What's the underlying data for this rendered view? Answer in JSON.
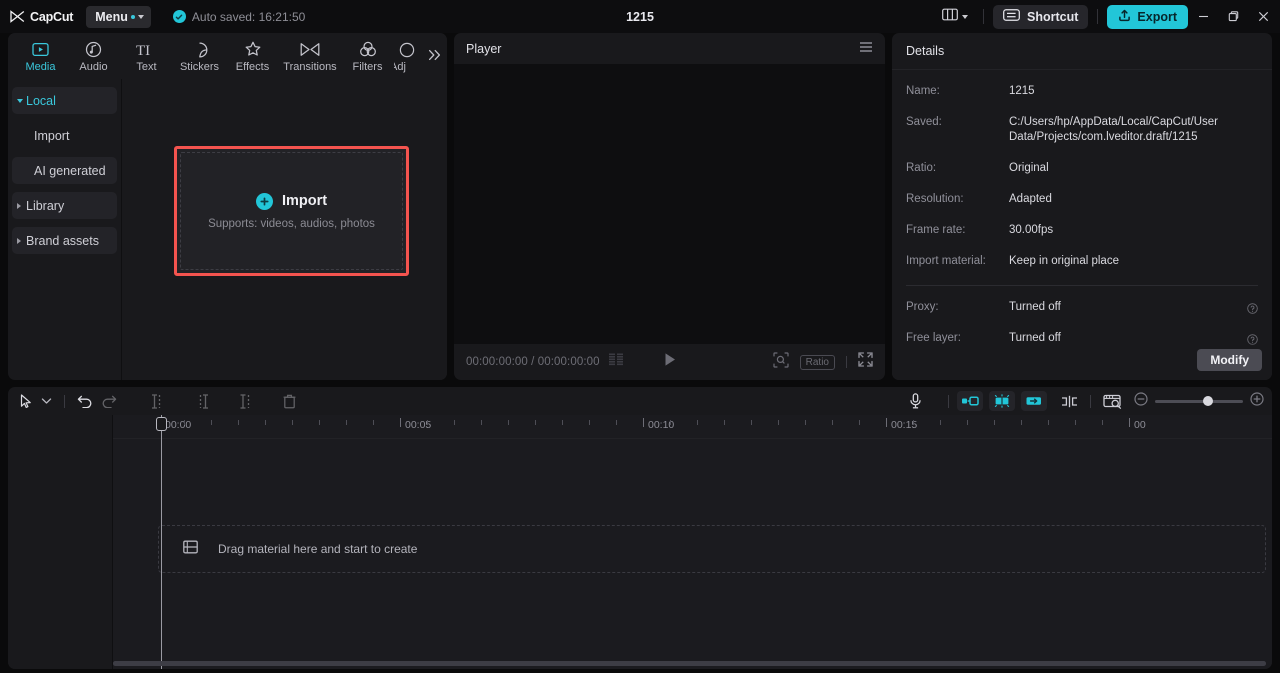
{
  "titlebar": {
    "brand": "CapCut",
    "menu_label": "Menu",
    "autosave_text": "Auto saved: 16:21:50",
    "project_title": "1215",
    "layout_icon": "layout-grid-icon",
    "shortcut_label": "Shortcut",
    "export_label": "Export",
    "minimize": "minimize-icon",
    "maximize": "maximize-icon",
    "close": "close-icon"
  },
  "tabs": [
    {
      "label": "Media",
      "icon": "media-play-icon",
      "active": true
    },
    {
      "label": "Audio",
      "icon": "audio-note-icon",
      "active": false
    },
    {
      "label": "Text",
      "icon": "text-ti-icon",
      "active": false
    },
    {
      "label": "Stickers",
      "icon": "sticker-icon",
      "active": false
    },
    {
      "label": "Effects",
      "icon": "effects-sparkle-icon",
      "active": false
    },
    {
      "label": "Transitions",
      "icon": "transitions-bowtie-icon",
      "active": false
    },
    {
      "label": "Filters",
      "icon": "filters-circles-icon",
      "active": false
    },
    {
      "label": "Adj",
      "icon": "adjust-icon",
      "active": false
    }
  ],
  "tabs_expand_icon": "chevron-double-right-icon",
  "sidenav": [
    {
      "label": "Local",
      "state": "expanded",
      "selected": true
    },
    {
      "label": "Import",
      "state": "child",
      "selected": false
    },
    {
      "label": "AI generated",
      "state": "child-boxed",
      "selected": false
    },
    {
      "label": "Library",
      "state": "collapsed",
      "selected": false
    },
    {
      "label": "Brand assets",
      "state": "collapsed",
      "selected": false
    }
  ],
  "import_zone": {
    "label": "Import",
    "sub": "Supports: videos, audios, photos",
    "plus_icon": "plus-circle-icon",
    "highlight_color": "#f4544f"
  },
  "player": {
    "title": "Player",
    "menu_icon": "hamburger-icon",
    "current_time": "00:00:00:00",
    "separator": "/",
    "total_time": "00:00:00:00",
    "list_icon": "frames-icon",
    "play_icon": "play-icon",
    "magnifier_icon": "zoom-select-icon",
    "ratio_label": "Ratio",
    "fullscreen_icon": "fullscreen-icon"
  },
  "details": {
    "title": "Details",
    "rows": [
      {
        "label": "Name:",
        "value": "1215",
        "help": false
      },
      {
        "label": "Saved:",
        "value": "C:/Users/hp/AppData/Local/CapCut/User Data/Projects/com.lveditor.draft/1215",
        "help": false
      },
      {
        "label": "Ratio:",
        "value": "Original",
        "help": false
      },
      {
        "label": "Resolution:",
        "value": "Adapted",
        "help": false
      },
      {
        "label": "Frame rate:",
        "value": "30.00fps",
        "help": false
      },
      {
        "label": "Import material:",
        "value": "Keep in original place",
        "help": false
      }
    ],
    "rows_after_divider": [
      {
        "label": "Proxy:",
        "value": "Turned off",
        "help": true
      },
      {
        "label": "Free layer:",
        "value": "Turned off",
        "help": true
      }
    ],
    "modify_label": "Modify",
    "help_icon": "question-circle-icon"
  },
  "timeline_toolbar": {
    "cursor_icon": "cursor-arrow-icon",
    "cursor_caret": "chevron-down-icon",
    "undo_icon": "undo-icon",
    "redo_icon": "redo-icon",
    "trim_start_icon": "trim-left-icon",
    "trim_end_icon": "trim-right-icon",
    "split_icon": "split-icon",
    "delete_icon": "trash-icon",
    "mic_icon": "microphone-icon",
    "key_prev_icon": "keyframe-prev-icon",
    "key_add_icon": "keyframe-add-icon",
    "key_next_icon": "keyframe-next-icon",
    "mirror_icon": "mirror-split-icon",
    "crop_icon": "crop-preview-icon",
    "zoom_out_icon": "zoom-out-icon",
    "zoom_in_icon": "zoom-in-icon",
    "zoom_value": 48
  },
  "timeline": {
    "ruler_labels": [
      "00:00",
      "00:05",
      "00:10",
      "00:15",
      "00"
    ],
    "playhead_time": "00:00",
    "dropzone_text": "Drag material here and start to create",
    "dropzone_icon": "filmstrip-icon"
  }
}
